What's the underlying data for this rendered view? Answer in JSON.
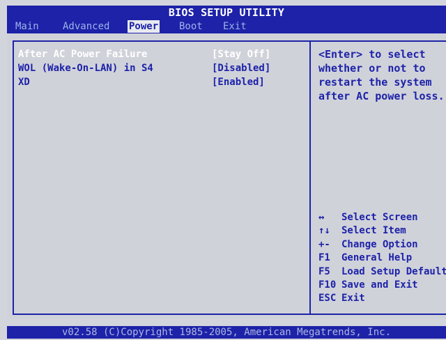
{
  "title": "BIOS SETUP UTILITY",
  "menu": [
    {
      "label": "Main",
      "active": false
    },
    {
      "label": "Advanced",
      "active": false
    },
    {
      "label": "Power",
      "active": true
    },
    {
      "label": "Boot",
      "active": false
    },
    {
      "label": "Exit",
      "active": false
    }
  ],
  "settings": [
    {
      "label": "After AC Power Failure",
      "value": "[Stay Off]",
      "selected": true
    },
    {
      "label": "WOL (Wake-On-LAN) in S4",
      "value": "[Disabled]",
      "selected": false
    },
    {
      "label": "XD",
      "value": "[Enabled]",
      "selected": false
    }
  ],
  "help": {
    "lines": [
      "<Enter> to select",
      "whether or not to",
      "restart the system",
      "after AC power loss."
    ]
  },
  "key_legend": [
    {
      "key": "↔",
      "desc": "Select Screen"
    },
    {
      "key": "↑↓",
      "desc": "Select Item"
    },
    {
      "key": "+-",
      "desc": "Change Option"
    },
    {
      "key": "F1",
      "desc": "General Help"
    },
    {
      "key": "F5",
      "desc": "Load Setup Defaults"
    },
    {
      "key": "F10",
      "desc": "Save and Exit"
    },
    {
      "key": "ESC",
      "desc": "Exit"
    }
  ],
  "footer": "v02.58 (C)Copyright 1985-2005, American Megatrends, Inc.",
  "colors": {
    "bios_blue": "#1d22a8",
    "panel_gray": "#d0d2da",
    "selected_text": "#ffffff",
    "inactive_tab_text": "#9fb2ea"
  }
}
